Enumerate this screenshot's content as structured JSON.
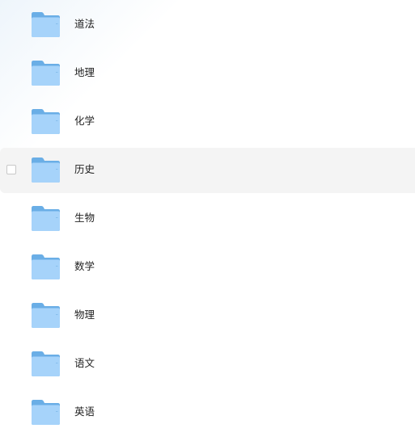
{
  "folders": [
    {
      "name": "道法",
      "icon": "folder-icon"
    },
    {
      "name": "地理",
      "icon": "folder-icon"
    },
    {
      "name": "化学",
      "icon": "folder-icon"
    },
    {
      "name": "历史",
      "icon": "folder-icon"
    },
    {
      "name": "生物",
      "icon": "folder-icon"
    },
    {
      "name": "数学",
      "icon": "folder-icon"
    },
    {
      "name": "物理",
      "icon": "folder-icon"
    },
    {
      "name": "语文",
      "icon": "folder-icon"
    },
    {
      "name": "英语",
      "icon": "folder-icon"
    }
  ],
  "hovered_index": 3,
  "colors": {
    "folder_back": "#6aaee6",
    "folder_front": "#a6d3fa",
    "hover_row": "#f4f4f4"
  }
}
